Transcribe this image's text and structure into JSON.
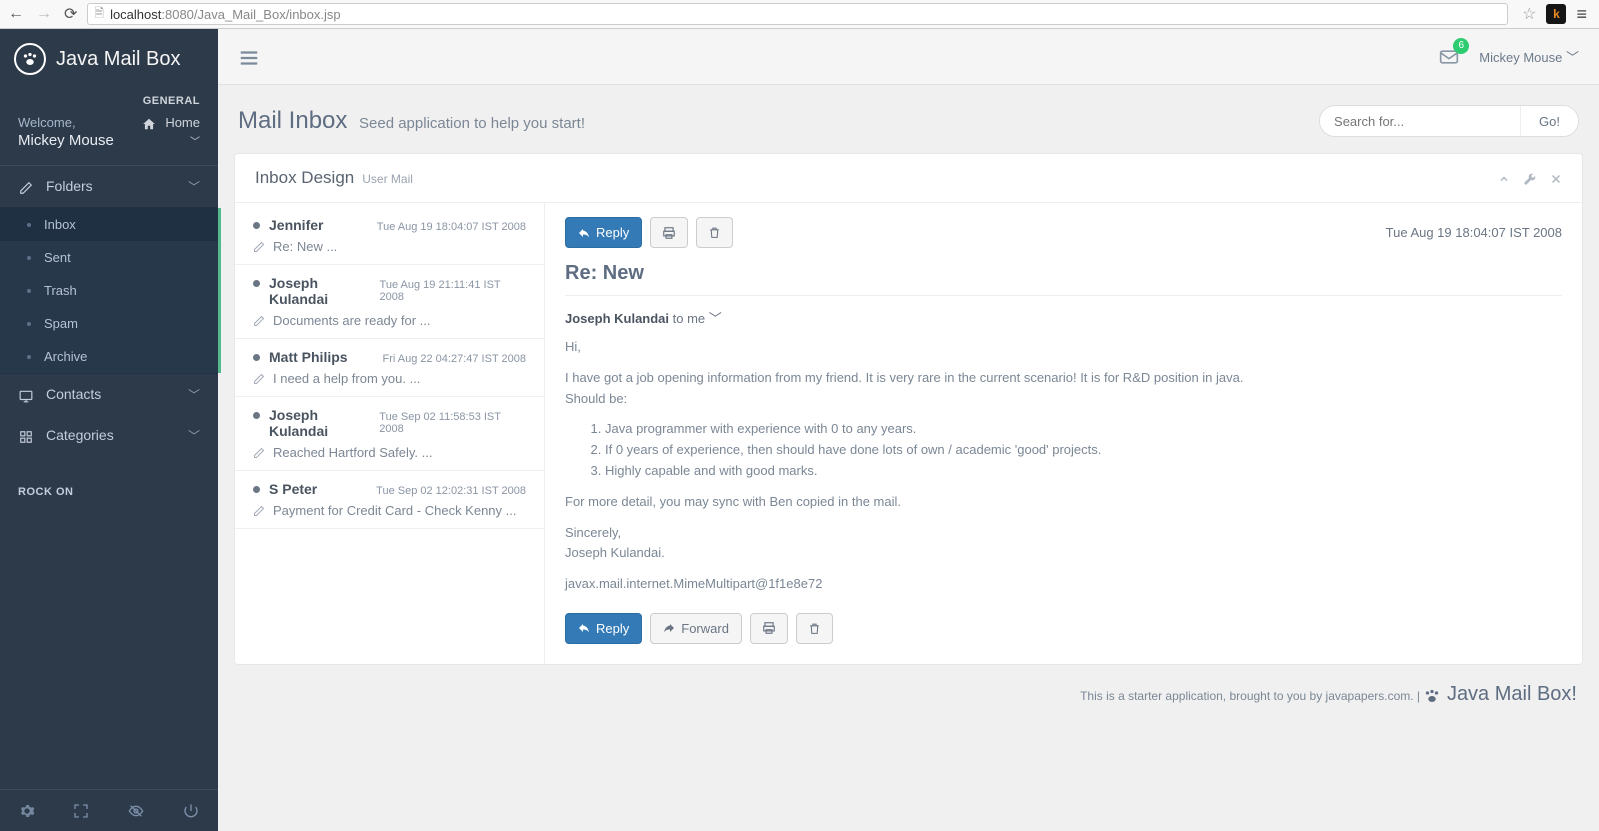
{
  "browser": {
    "url_host": "localhost",
    "url_port": ":8080",
    "url_path": "/Java_Mail_Box/inbox.jsp"
  },
  "app": {
    "brand": "Java Mail Box",
    "section_general": "GENERAL",
    "welcome": "Welcome,",
    "username": "Mickey Mouse",
    "home_label": "Home",
    "nav": {
      "folders": "Folders",
      "subfolders": {
        "inbox": "Inbox",
        "sent": "Sent",
        "trash": "Trash",
        "spam": "Spam",
        "archive": "Archive"
      },
      "contacts": "Contacts",
      "categories": "Categories",
      "rock_on": "ROCK ON"
    },
    "topbar": {
      "notif_count": "6",
      "user_dropdown": "Mickey Mouse"
    },
    "page": {
      "title": "Mail Inbox",
      "subtitle": "Seed application to help you start!",
      "search_placeholder": "Search for...",
      "search_button": "Go!"
    },
    "panel": {
      "title": "Inbox Design",
      "subtitle": "User Mail"
    },
    "messages": [
      {
        "sender": "Jennifer",
        "date": "Tue Aug 19 18:04:07 IST 2008",
        "subject": "Re: New ..."
      },
      {
        "sender": "Joseph Kulandai",
        "date": "Tue Aug 19 21:11:41 IST 2008",
        "subject": "Documents are ready for ..."
      },
      {
        "sender": "Matt Philips",
        "date": "Fri Aug 22 04:27:47 IST 2008",
        "subject": "I need a help from you. ..."
      },
      {
        "sender": "Joseph Kulandai",
        "date": "Tue Sep 02 11:58:53 IST 2008",
        "subject": "Reached Hartford Safely. ..."
      },
      {
        "sender": "S Peter",
        "date": "Tue Sep 02 12:02:31 IST 2008",
        "subject": "Payment for Credit Card - Check Kenny ..."
      }
    ],
    "view": {
      "reply_label": "Reply",
      "forward_label": "Forward",
      "date": "Tue Aug 19 18:04:07 IST 2008",
      "subject": "Re: New",
      "from_name": "Joseph Kulandai",
      "to_label": " to me ",
      "body": {
        "greeting": "Hi,",
        "intro": "I have got a job opening information from my friend. It is very rare in the current scenario! It is for R&D position in java.",
        "should_be": "Should be:",
        "li1": "Java programmer with experience with 0 to any years.",
        "li2": "If 0 years of experience, then should have done lots of own / academic 'good' projects.",
        "li3": "Highly capable and with good marks.",
        "detail": "For more detail, you may sync with Ben copied in the mail.",
        "sign1": "Sincerely,",
        "sign2": "Joseph Kulandai.",
        "mime": "javax.mail.internet.MimeMultipart@1f1e8e72"
      }
    },
    "footer": {
      "text": "This is a starter application, brought to you by javapapers.com. | ",
      "brand": "Java Mail Box!"
    }
  }
}
